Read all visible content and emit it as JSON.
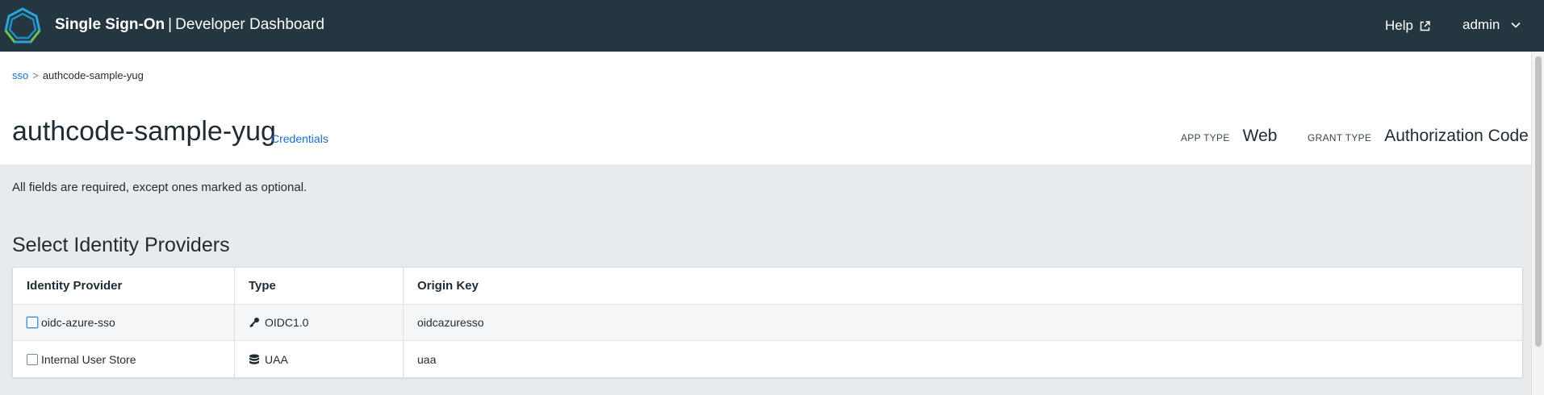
{
  "header": {
    "brand_bold": "Single Sign-On",
    "separator": "|",
    "brand_light": "Developer Dashboard",
    "help_label": "Help",
    "user_label": "admin"
  },
  "breadcrumb": {
    "root": "sso",
    "separator": ">",
    "current": "authcode-sample-yug"
  },
  "app": {
    "title": "authcode-sample-yug",
    "credentials_link": "Credentials",
    "app_type_label": "APP TYPE",
    "app_type_value": "Web",
    "grant_type_label": "GRANT TYPE",
    "grant_type_value": "Authorization Code"
  },
  "form": {
    "note": "All fields are required, except ones marked as optional.",
    "section_title": "Select Identity Providers"
  },
  "table": {
    "columns": [
      "Identity Provider",
      "Type",
      "Origin Key"
    ],
    "rows": [
      {
        "provider": "oidc-azure-sso",
        "type": "OIDC1.0",
        "type_icon": "key-icon",
        "origin_key": "oidcazuresso",
        "checked": false
      },
      {
        "provider": "Internal User Store",
        "type": "UAA",
        "type_icon": "database-icon",
        "origin_key": "uaa",
        "checked": false
      }
    ]
  },
  "colors": {
    "header_bg": "#243640",
    "link": "#1a6fc4",
    "page_bg": "#e8ebee"
  }
}
